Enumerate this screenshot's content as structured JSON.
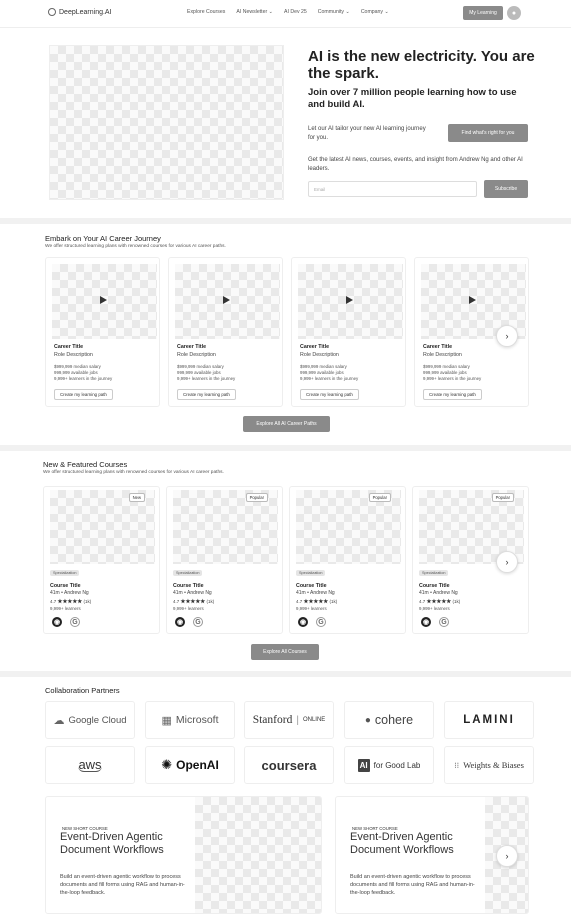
{
  "nav": {
    "logo": "DeepLearning.AI",
    "links": [
      "Explore Courses",
      "AI Newsletter ⌄",
      "AI Dev 25",
      "Community ⌄",
      "Company ⌄"
    ],
    "my_learning": "My Learning"
  },
  "hero": {
    "title": "AI is the new electricity. You are the spark.",
    "subtitle": "Join over 7 million people learning how to use and build AI.",
    "tailor_text": "Let our AI tailor your new AI learning journey for you.",
    "find_button": "Find what's right for you",
    "news_text": "Get the latest AI news, courses, events, and insight from Andrew Ng and other AI leaders.",
    "email_placeholder": "Email",
    "subscribe_button": "Subscribe"
  },
  "career": {
    "title": "Embark on Your AI Career Journey",
    "subtitle": "We offer structured learning plans with renowned courses for various AI career paths.",
    "cards": [
      {
        "title": "Career Title",
        "role": "Role Description",
        "salary": "$999,999 median salary",
        "jobs": "999,999 available jobs",
        "learners": "9,999+ learners in the journey",
        "button": "Create my learning path"
      },
      {
        "title": "Career Title",
        "role": "Role Description",
        "salary": "$999,999 median salary",
        "jobs": "999,999 available jobs",
        "learners": "9,999+ learners in the journey",
        "button": "Create my learning path"
      },
      {
        "title": "Career Title",
        "role": "Role Description",
        "salary": "$999,999 median salary",
        "jobs": "999,999 available jobs",
        "learners": "9,999+ learners in the journey",
        "button": "Create my learning path"
      },
      {
        "title": "Career Title",
        "role": "Role Description",
        "salary": "$999,999 median salary",
        "jobs": "999,999 available jobs",
        "learners": "9,999+ learners in the journey",
        "button": "Create my learning path"
      }
    ],
    "explore_button": "Explore All AI Career Paths"
  },
  "courses": {
    "title": "New & Featured Courses",
    "subtitle": "We offer structured learning plans with renowned courses for various AI career paths.",
    "cards": [
      {
        "badge": "New",
        "tag": "Specialization",
        "title": "Course Title",
        "meta": "41m • Andrew Ng",
        "rating": "4.7",
        "reviews": "(1k)",
        "learners": "9,999+ learners"
      },
      {
        "badge": "Popular",
        "tag": "Specialization",
        "title": "Course Title",
        "meta": "41m • Andrew Ng",
        "rating": "4.7",
        "reviews": "(1k)",
        "learners": "9,999+ learners"
      },
      {
        "badge": "Popular",
        "tag": "Specialization",
        "title": "Course Title",
        "meta": "41m • Andrew Ng",
        "rating": "4.7",
        "reviews": "(1k)",
        "learners": "9,999+ learners"
      },
      {
        "badge": "Popular",
        "tag": "Specialization",
        "title": "Course Title",
        "meta": "41m • Andrew Ng",
        "rating": "4.7",
        "reviews": "(1k)",
        "learners": "9,999+ learners"
      }
    ],
    "explore_button": "Explore All Courses"
  },
  "partners": {
    "title": "Collaboration Partners",
    "logos": [
      "Google Cloud",
      "Microsoft",
      "Stanford",
      "ONLINE",
      "cohere",
      "LAMINI",
      "aws",
      "OpenAI",
      "coursera",
      "AI",
      "for Good Lab",
      "Weights & Biases"
    ]
  },
  "promos": [
    {
      "kicker": "NEW SHORT COURSE",
      "title": "Event-Driven Agentic Document Workflows",
      "desc": "Build an event-driven agentic workflow to process documents and fill forms using RAG and human-in-the-loop feedback."
    },
    {
      "kicker": "NEW SHORT COURSE",
      "title": "Event-Driven Agentic Document Workflows",
      "desc": "Build an event-driven agentic workflow to process documents and fill forms using RAG and human-in-the-loop feedback."
    }
  ]
}
